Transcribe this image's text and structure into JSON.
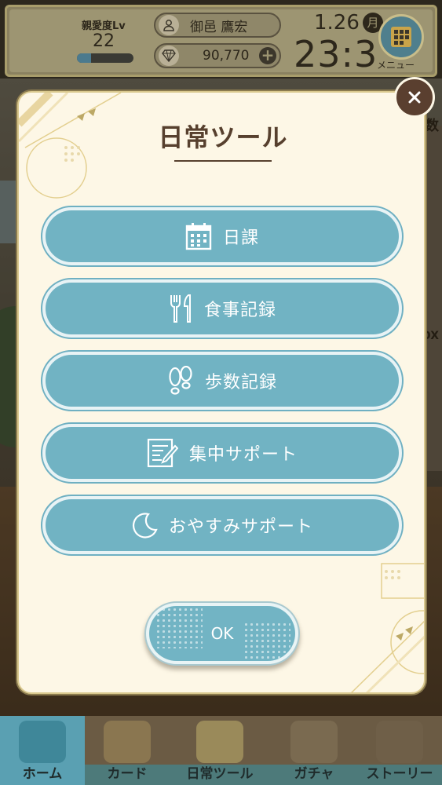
{
  "status_bar": {
    "affinity_label": "親愛度Lv",
    "affinity_level": "22",
    "affinity_progress": 0.25,
    "user_name": "御邑 鷹宏",
    "currency_amount": "90,770",
    "date": "1.26",
    "weekday": "月",
    "time": "23:3",
    "menu_label": "メニュー"
  },
  "background": {
    "side_text_1": "数",
    "side_text_2": "BOX"
  },
  "modal": {
    "title": "日常ツール",
    "buttons": [
      {
        "label": "日課",
        "icon": "calendar-icon"
      },
      {
        "label": "食事記録",
        "icon": "fork-knife-icon"
      },
      {
        "label": "歩数記録",
        "icon": "footprints-icon"
      },
      {
        "label": "集中サポート",
        "icon": "notepad-pencil-icon"
      },
      {
        "label": "おやすみサポート",
        "icon": "moon-icon"
      }
    ],
    "ok_label": "OK",
    "close_glyph": "×"
  },
  "bottom_nav": {
    "items": [
      {
        "label": "ホーム",
        "icon": "house-bear-icon"
      },
      {
        "label": "カード",
        "icon": "cards-icon"
      },
      {
        "label": "日常ツール",
        "icon": "clipboard-icon"
      },
      {
        "label": "ガチャ",
        "icon": "gift-bag-icon"
      },
      {
        "label": "ストーリー",
        "icon": "book-icon"
      }
    ]
  },
  "colors": {
    "button_fill": "#71b3c3",
    "modal_bg": "#fdf7e6",
    "title_brown": "#57402e",
    "close_bg": "#5a3f2f"
  }
}
